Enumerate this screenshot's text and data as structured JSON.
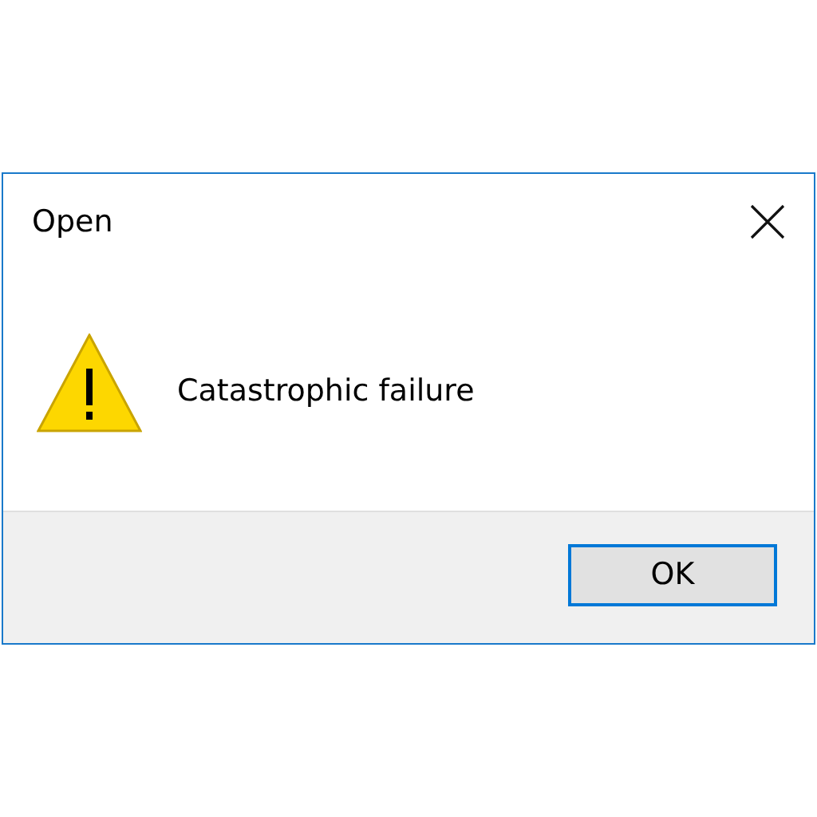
{
  "window": {
    "title": "Open"
  },
  "message": "Catastrophic failure",
  "buttons": [
    {
      "label": "OK",
      "selected": true
    }
  ]
}
